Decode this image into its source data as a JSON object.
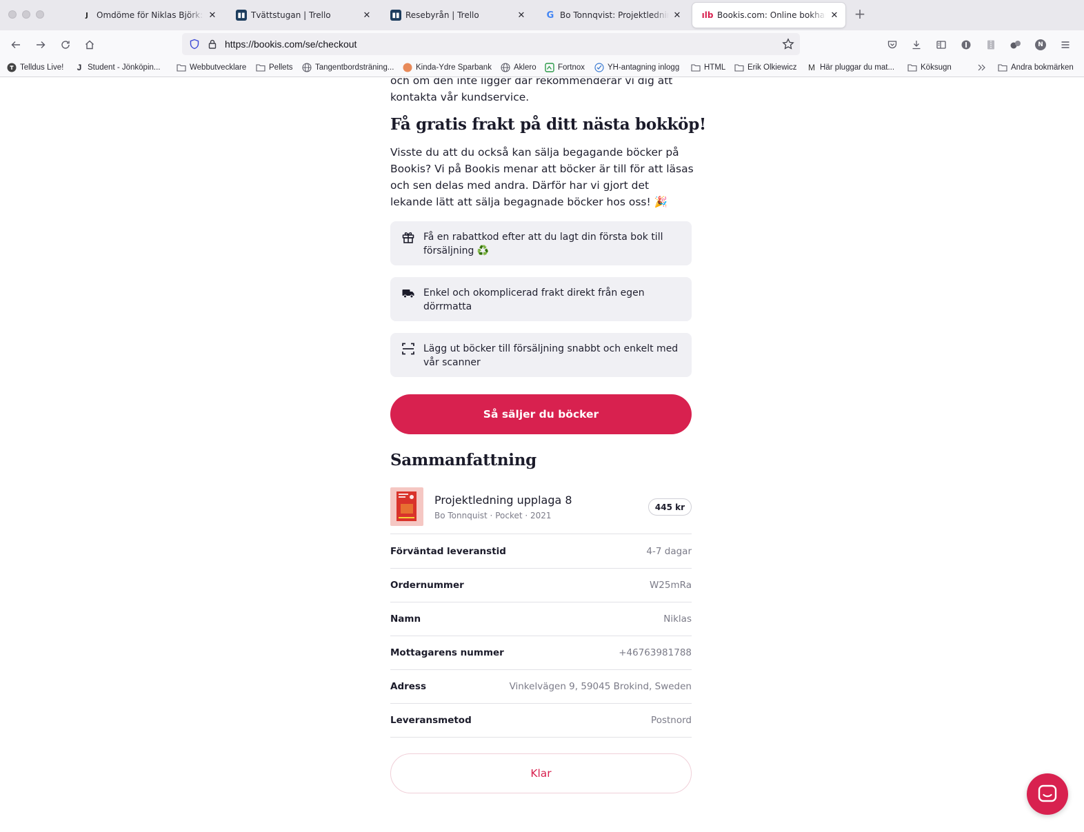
{
  "browser": {
    "tabs": [
      {
        "title": "Omdöme för Niklas Björk: Dynamic",
        "favicon": "j-logo-icon",
        "active": false
      },
      {
        "title": "Tvättstugan | Trello",
        "favicon": "trello-icon",
        "active": false
      },
      {
        "title": "Resebyrån | Trello",
        "favicon": "trello-icon",
        "active": false
      },
      {
        "title": "Bo Tonnqvist: Projektledning upplaga",
        "favicon": "google-icon",
        "active": false
      },
      {
        "title": "Bookis.com: Online bokhandel för",
        "favicon": "bookis-icon",
        "active": true
      }
    ],
    "url": "https://bookis.com/se/checkout",
    "bookmarks": [
      {
        "label": "Telldus Live!",
        "icon": "telldus-icon"
      },
      {
        "label": "Student - Jönköpin...",
        "icon": "j-logo-icon"
      },
      {
        "label": "Webbutvecklare",
        "icon": "folder-icon"
      },
      {
        "label": "Pellets",
        "icon": "folder-icon"
      },
      {
        "label": "Tangentbordsträning...",
        "icon": "globe-icon"
      },
      {
        "label": "Kinda-Ydre Sparbank",
        "icon": "bank-icon"
      },
      {
        "label": "Aklero",
        "icon": "globe-icon"
      },
      {
        "label": "Fortnox",
        "icon": "fortnox-icon"
      },
      {
        "label": "YH-antagning inlogg",
        "icon": "check-icon"
      },
      {
        "label": "HTML",
        "icon": "folder-icon"
      },
      {
        "label": "Erik Olkiewicz",
        "icon": "folder-icon"
      },
      {
        "label": "Här pluggar du mat...",
        "icon": "m-logo-icon"
      },
      {
        "label": "Köksugn",
        "icon": "folder-icon"
      }
    ],
    "other_bookmarks": "Andra bokmärken",
    "profile_initial": "N",
    "colors": {
      "tabbar": "#e9e8ed",
      "toolbar": "#f9f9fb"
    }
  },
  "page": {
    "intro_tail": "och om den inte ligger dar rekommenderar vi dig att kontakta vår kundservice.",
    "free_shipping": {
      "heading": "Få gratis frakt på ditt nästa bokköp!",
      "text": "Visste du att du också kan sälja begagande böcker på Bookis? Vi på Bookis menar att böcker är till för att läsas och sen delas med andra. Därför har vi gjort det lekande lätt att sälja begagnade böcker hos oss! 🎉"
    },
    "features": [
      {
        "icon": "gift-icon",
        "text": "Få en rabattkod efter att du lagt din första bok till försäljning ♻️"
      },
      {
        "icon": "truck-icon",
        "text": "Enkel och okomplicerad frakt direkt från egen dörrmatta"
      },
      {
        "icon": "scan-icon",
        "text": "Lägg ut böcker till försäljning snabbt och enkelt med vår scanner"
      }
    ],
    "sell_button": "Så säljer du böcker",
    "summary": {
      "heading": "Sammanfattning",
      "book": {
        "title": "Projektledning upplaga 8",
        "meta": "Bo Tonnquist · Pocket · 2021",
        "price": "445 kr"
      },
      "rows": [
        {
          "label": "Förväntad leveranstid",
          "value": "4-7 dagar"
        },
        {
          "label": "Ordernummer",
          "value": "W25mRa"
        },
        {
          "label": "Namn",
          "value": "Niklas"
        },
        {
          "label": "Mottagarens nummer",
          "value": "+46763981788"
        },
        {
          "label": "Adress",
          "value": "Vinkelvägen 9, 59045 Brokind, Sweden"
        },
        {
          "label": "Leveransmetod",
          "value": "Postnord"
        }
      ]
    },
    "done_button": "Klar",
    "colors": {
      "accent": "#d8214f",
      "feature_bg": "#f0f0f4",
      "muted_text": "#7b7b88"
    }
  }
}
